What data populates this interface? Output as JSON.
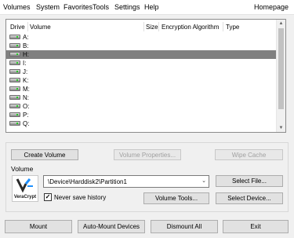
{
  "menu": {
    "items": [
      "Volumes",
      "System",
      "Favorites",
      "Tools",
      "Settings",
      "Help"
    ],
    "homepage": "Homepage"
  },
  "volume_list": {
    "columns": [
      "Drive",
      "Volume",
      "Size",
      "Encryption Algorithm",
      "Type"
    ],
    "drives": [
      "A:",
      "B:",
      "H:",
      "I:",
      "J:",
      "K:",
      "M:",
      "N:",
      "O:",
      "P:",
      "Q:"
    ],
    "selected_drive": "H:"
  },
  "buttons": {
    "create_volume": "Create Volume",
    "volume_properties": "Volume Properties...",
    "wipe_cache": "Wipe Cache",
    "select_file": "Select File...",
    "volume_tools": "Volume Tools...",
    "select_device": "Select Device...",
    "mount": "Mount",
    "auto_mount": "Auto-Mount Devices",
    "dismount_all": "Dismount All",
    "exit": "Exit"
  },
  "volume_group": {
    "label": "Volume",
    "path": "\\Device\\Harddisk2\\Partition1",
    "never_save_history": "Never save history",
    "never_save_history_checked": true,
    "logo_text": "VeraCrypt"
  },
  "colors": {
    "selection": "#808080",
    "logo_accent": "#1e90ff"
  }
}
